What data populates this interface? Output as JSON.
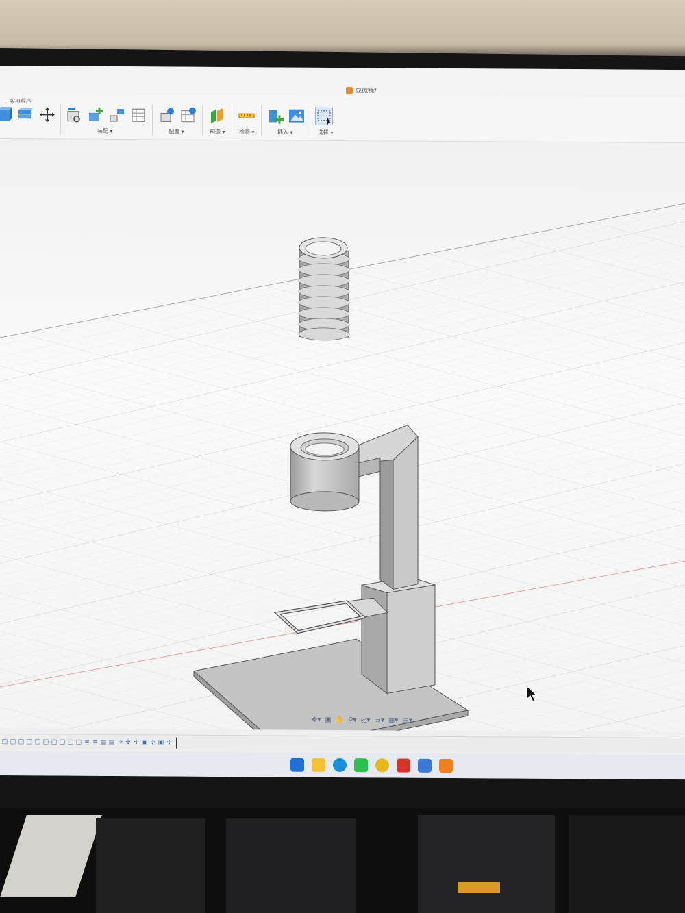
{
  "window": {
    "document_title": "显微镜*"
  },
  "toolbar": {
    "tab_label": "实用程序",
    "groups": [
      {
        "label": "装配 ▾"
      },
      {
        "label": "配置 ▾"
      },
      {
        "label": "构造 ▾"
      },
      {
        "label": "检验 ▾"
      },
      {
        "label": "插入 ▾"
      },
      {
        "label": "选择 ▾"
      }
    ],
    "icons": [
      "box-tool-icon",
      "extrude-tool-icon",
      "move-icon",
      "new-component-icon",
      "joint-icon",
      "as-built-joint-icon",
      "table-icon",
      "configure-icon",
      "configure-table-icon",
      "plane-icon",
      "measure-icon",
      "insert-mesh-icon",
      "insert-image-icon",
      "select-window-icon"
    ],
    "accent": "#2f7fd6"
  },
  "viewport": {
    "model": "microscope",
    "parts": [
      "threaded-tube",
      "lens-ring-arm",
      "stage",
      "pillar",
      "base-plate"
    ],
    "background": "#f5f5f5"
  },
  "nav_bar": {
    "icons": [
      "orbit-icon",
      "look-at-icon",
      "pan-icon",
      "zoom-icon",
      "fit-icon",
      "display-icon",
      "grid-icon",
      "viewports-icon"
    ],
    "glyphs": [
      "✥▾",
      "▣",
      "✋",
      "⚲▾",
      "◎▾",
      "▭▾",
      "▦▾",
      "▤▾"
    ]
  },
  "timeline": {
    "items": [
      "□",
      "□",
      "□",
      "□",
      "□",
      "□",
      "□",
      "□",
      "□",
      "□",
      "≡",
      "≡",
      "▤",
      "▤",
      "⇥",
      "✣",
      "✣",
      "▣",
      "✣",
      "▣",
      "✣"
    ]
  },
  "taskbar": {
    "apps": [
      {
        "name": "windows-start-icon",
        "color": "#1f6fd6"
      },
      {
        "name": "file-explorer-icon",
        "color": "#f2c230"
      },
      {
        "name": "edge-icon",
        "color": "#1b8fd8"
      },
      {
        "name": "wechat-icon",
        "color": "#2dbf4e"
      },
      {
        "name": "chrome-icon",
        "color": "#e6b818"
      },
      {
        "name": "wps-icon",
        "color": "#d8332a"
      },
      {
        "name": "store-icon",
        "color": "#3a7ad4"
      },
      {
        "name": "fusion-icon",
        "color": "#f0801e"
      }
    ]
  }
}
